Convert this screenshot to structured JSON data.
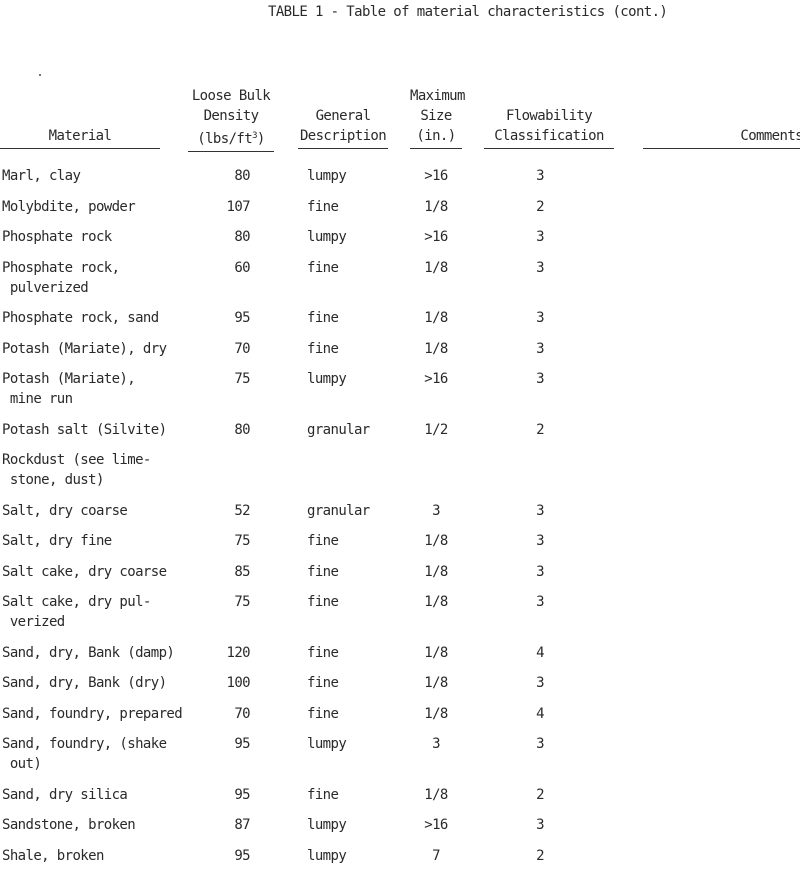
{
  "title": "TABLE 1 - Table of material characteristics (cont.)",
  "headers": {
    "material": "Material",
    "density_l1": "Loose Bulk",
    "density_l2": "Density",
    "density_l3": "(lbs/ft",
    "density_sup": "3",
    "density_l3_end": ")",
    "desc_l1": "General",
    "desc_l2": "Description",
    "size_l1": "Maximum",
    "size_l2": "Size",
    "size_l3": "(in.)",
    "flow_l1": "Flowability",
    "flow_l2": "Classification",
    "comments": "Comments"
  },
  "rows": [
    {
      "material": "Marl, clay",
      "density": "80",
      "description": "lumpy",
      "max_size": ">16",
      "flowability": "3",
      "comments": ""
    },
    {
      "material": "Molybdite, powder",
      "density": "107",
      "description": "fine",
      "max_size": "1/8",
      "flowability": "2",
      "comments": ""
    },
    {
      "material": "Phosphate rock",
      "density": "80",
      "description": "lumpy",
      "max_size": ">16",
      "flowability": "3",
      "comments": ""
    },
    {
      "material": "Phosphate rock,\n pulverized",
      "density": "60",
      "description": "fine",
      "max_size": "1/8",
      "flowability": "3",
      "comments": ""
    },
    {
      "material": "Phosphate rock, sand",
      "density": "95",
      "description": "fine",
      "max_size": "1/8",
      "flowability": "3",
      "comments": ""
    },
    {
      "material": "Potash (Mariate), dry",
      "density": "70",
      "description": "fine",
      "max_size": "1/8",
      "flowability": "3",
      "comments": ""
    },
    {
      "material": "Potash (Mariate),\n mine run",
      "density": "75",
      "description": "lumpy",
      "max_size": ">16",
      "flowability": "3",
      "comments": ""
    },
    {
      "material": "Potash salt (Silvite)",
      "density": "80",
      "description": "granular",
      "max_size": "1/2",
      "flowability": "2",
      "comments": ""
    },
    {
      "material": "Rockdust (see lime-\n stone, dust)",
      "density": "",
      "description": "",
      "max_size": "",
      "flowability": "",
      "comments": ""
    },
    {
      "material": "Salt, dry coarse",
      "density": "52",
      "description": "granular",
      "max_size": "3",
      "flowability": "3",
      "comments": ""
    },
    {
      "material": "Salt, dry fine",
      "density": "75",
      "description": "fine",
      "max_size": "1/8",
      "flowability": "3",
      "comments": ""
    },
    {
      "material": "Salt cake, dry coarse",
      "density": "85",
      "description": "fine",
      "max_size": "1/8",
      "flowability": "3",
      "comments": ""
    },
    {
      "material": "Salt cake, dry pul-\n verized",
      "density": "75",
      "description": "fine",
      "max_size": "1/8",
      "flowability": "3",
      "comments": ""
    },
    {
      "material": "Sand, dry, Bank (damp)",
      "density": "120",
      "description": "fine",
      "max_size": "1/8",
      "flowability": "4",
      "comments": ""
    },
    {
      "material": "Sand, dry, Bank (dry)",
      "density": "100",
      "description": "fine",
      "max_size": "1/8",
      "flowability": "3",
      "comments": ""
    },
    {
      "material": "Sand, foundry, prepared",
      "density": "70",
      "description": "fine",
      "max_size": "1/8",
      "flowability": "4",
      "comments": ""
    },
    {
      "material": "Sand, foundry, (shake\n out)",
      "density": "95",
      "description": "lumpy",
      "max_size": "3",
      "flowability": "3",
      "comments": ""
    },
    {
      "material": "Sand, dry silica",
      "density": "95",
      "description": "fine",
      "max_size": "1/8",
      "flowability": "2",
      "comments": ""
    },
    {
      "material": "Sandstone, broken",
      "density": "87",
      "description": "lumpy",
      "max_size": ">16",
      "flowability": "3",
      "comments": ""
    },
    {
      "material": "Shale, broken",
      "density": "95",
      "description": "lumpy",
      "max_size": "7",
      "flowability": "2",
      "comments": ""
    }
  ]
}
